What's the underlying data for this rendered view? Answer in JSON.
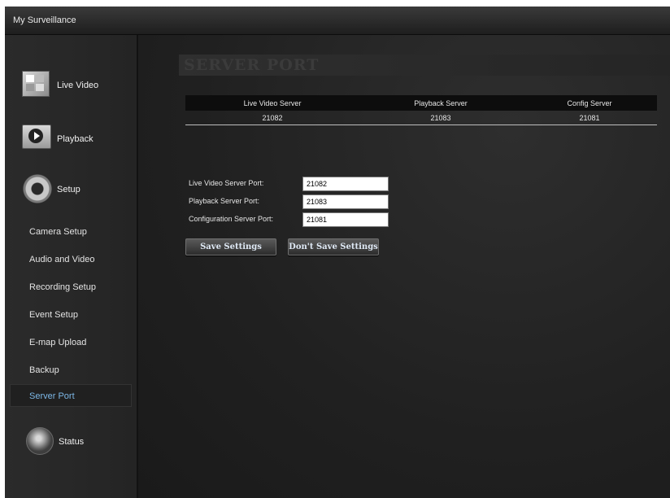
{
  "window": {
    "title": "My Surveillance"
  },
  "sidebar": {
    "sections": {
      "live_video": "Live Video",
      "playback": "Playback",
      "setup": "Setup",
      "status": "Status"
    },
    "setup_items": [
      {
        "label": "Camera Setup"
      },
      {
        "label": "Audio and Video"
      },
      {
        "label": "Recording Setup"
      },
      {
        "label": "Event Setup"
      },
      {
        "label": "E-map Upload"
      },
      {
        "label": "Backup"
      },
      {
        "label": "Server Port",
        "active": true
      }
    ]
  },
  "main": {
    "heading": "SERVER PORT",
    "ports_table": {
      "columns": [
        "Live Video Server",
        "Playback Server",
        "Config Server"
      ],
      "values": [
        "21082",
        "21083",
        "21081"
      ]
    },
    "form": {
      "live_label": "Live Video Server Port:",
      "live_value": "21082",
      "playback_label": "Playback Server Port:",
      "playback_value": "21083",
      "config_label": "Configuration Server Port:",
      "config_value": "21081"
    },
    "buttons": {
      "save": "Save Settings",
      "dont_save": "Don't Save Settings"
    }
  },
  "colors": {
    "background": "#1b1b1b",
    "sidebar": "#2b2b2b",
    "active_item_text": "#7cb7e6",
    "table_header": "#0d0d0d"
  }
}
